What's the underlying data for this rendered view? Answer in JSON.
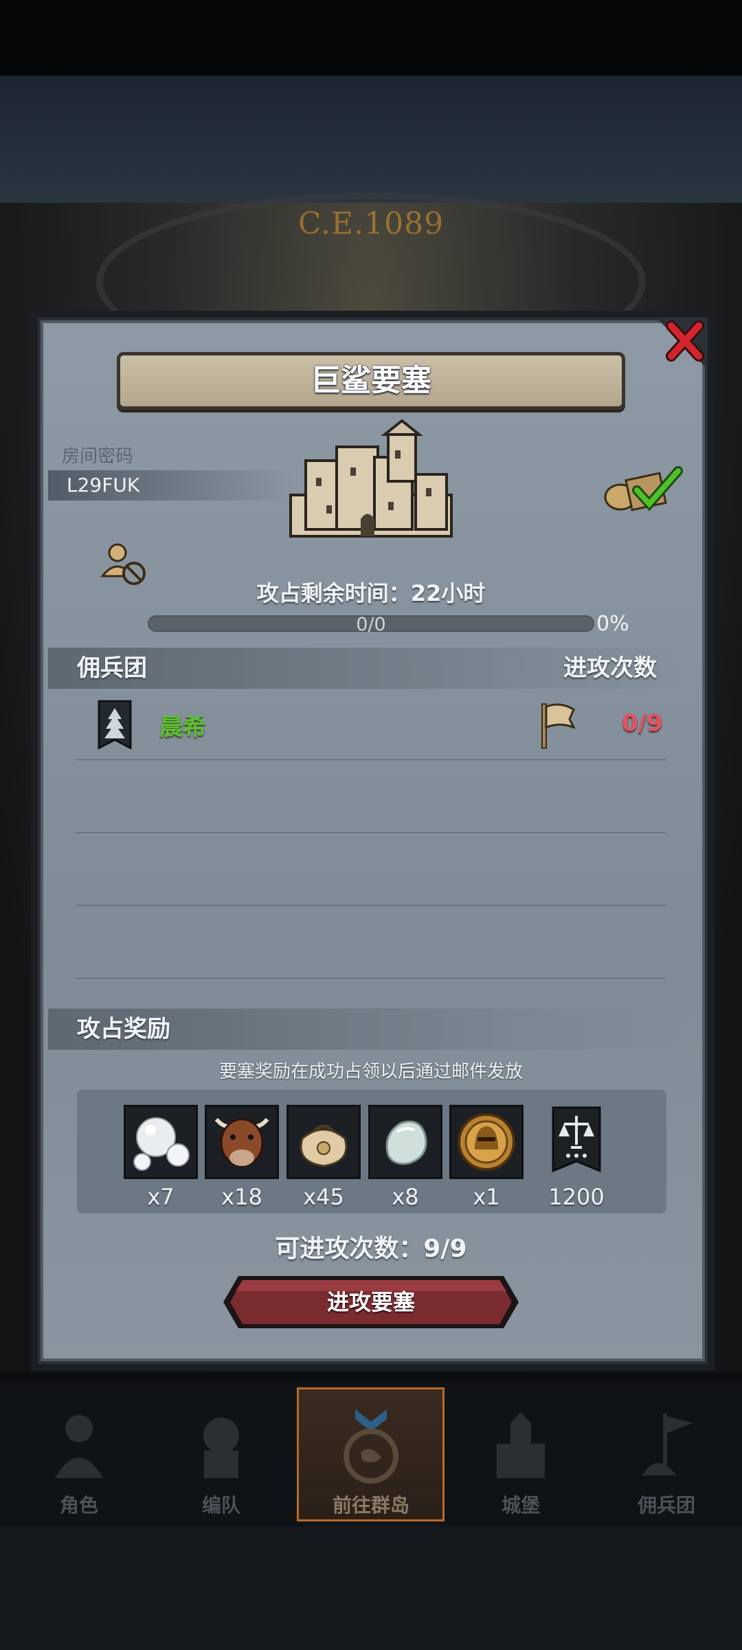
{
  "background": {
    "era_label": "C.E.1089"
  },
  "dialog": {
    "title": "巨鲨要塞",
    "room": {
      "label": "房间密码",
      "code": "L29FUK"
    },
    "capture_time": "攻占剩余时间：22小时",
    "progress": {
      "text": "0/0",
      "percent_text": "0%",
      "fill_fraction": 0
    },
    "mercenary_header": "佣兵团",
    "attack_count_header": "进攻次数",
    "mercenary_rows": [
      {
        "name": "晨希",
        "attacks": "0/9",
        "name_color": "#5fbf33",
        "attack_color": "#e55360"
      }
    ],
    "rewards_header": "攻占奖励",
    "rewards_note": "要塞奖励在成功占领以后通过邮件发放",
    "rewards": [
      {
        "item": "pearl-icon",
        "quantity": "x7"
      },
      {
        "item": "bull-icon",
        "quantity": "x18"
      },
      {
        "item": "coin-sack-icon",
        "quantity": "x45"
      },
      {
        "item": "stone-icon",
        "quantity": "x8"
      },
      {
        "item": "knight-medal-icon",
        "quantity": "x1"
      },
      {
        "item": "justice-banner-icon",
        "quantity": "1200"
      }
    ],
    "remaining_attacks": "可进攻次数：9/9",
    "attack_button": "进攻要塞"
  },
  "bottom_nav": [
    {
      "label": "角色",
      "icon": "character-icon"
    },
    {
      "label": "编队",
      "icon": "formation-icon"
    },
    {
      "label": "前往群岛",
      "icon": "island-compass-icon",
      "active": true
    },
    {
      "label": "城堡",
      "icon": "castle-icon"
    },
    {
      "label": "佣兵团",
      "icon": "mercenary-icon"
    }
  ],
  "colors": {
    "accent_red": "#7b2c31",
    "positive_green": "#5fbf33",
    "danger_red": "#e55360"
  }
}
